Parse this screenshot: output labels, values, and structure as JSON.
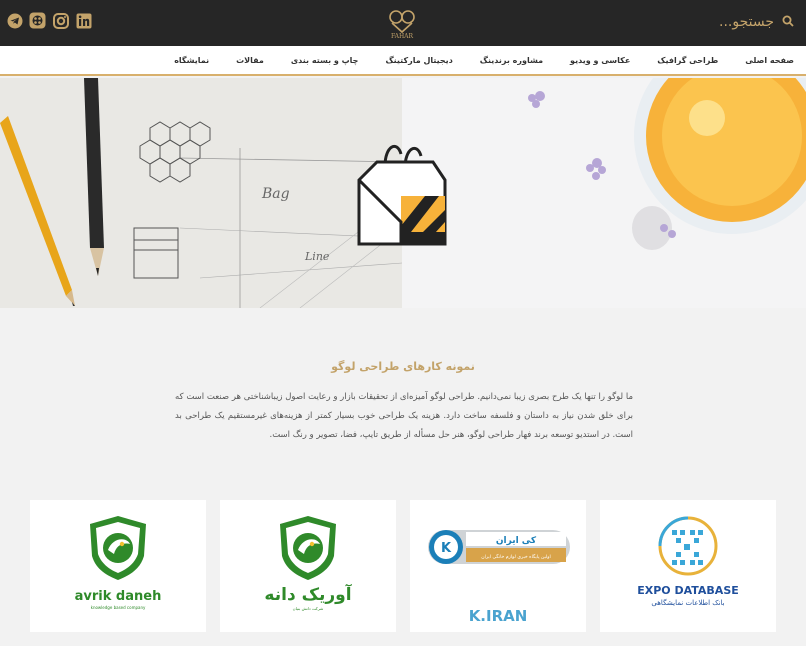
{
  "header": {
    "search_placeholder": "جستجو...",
    "logo_text": "FAHAR",
    "social": [
      {
        "name": "linkedin-icon"
      },
      {
        "name": "instagram-icon"
      },
      {
        "name": "aparat-icon"
      },
      {
        "name": "telegram-icon"
      }
    ]
  },
  "nav": {
    "items": [
      "صفحه اصلی",
      "طراحی گرافیک",
      "عکاسی و ویدیو",
      "مشاوره برندینگ",
      "دیجیتال مارکتینگ",
      "چاپ و بسته بندی",
      "مقالات",
      "نمایشگاه"
    ]
  },
  "section": {
    "title": "نمونه کارهای طراحی لوگو",
    "text": "ما لوگو را تنها یک طرح بصری زیبا نمی‌دانیم. طراحی لوگو آمیزه‌ای از تحقیقات بازار و رعایت اصول زیباشناختی هر صنعت است که برای خلق شدن نیاز به داستان و فلسفه ساخت دارد. هزینه یک طراحی خوب بسیار کمتر از هزینه‌های غیرمستقیم یک طراحی بد است. در استدیو توسعه برند فهار طراحی لوگو، هنر حل مسأله از طریق تایپ، فضا، تصویر و رنگ است."
  },
  "portfolio": {
    "cards": [
      {
        "name": "logo-card-avrik-daneh",
        "caption": "avrik daneh",
        "sub": "knowledge based company"
      },
      {
        "name": "logo-card-avrik-daneh-fa",
        "caption": "آوریک دانه",
        "sub": "شرکت دانش بنیان"
      },
      {
        "name": "logo-card-k-iran",
        "caption": "K.IRAN",
        "badge_title": "کی ایران",
        "badge_sub": "اولین پایگاه خبری لوازم خانگی ایران"
      },
      {
        "name": "logo-card-expo-database",
        "caption": "EXPO DATABASE",
        "sub": "بانک اطلاعات نمایشگاهی"
      }
    ]
  },
  "colors": {
    "accent": "#c3a36a",
    "dark": "#262626",
    "green": "#2f8a2a",
    "blue": "#1f4f9c"
  }
}
